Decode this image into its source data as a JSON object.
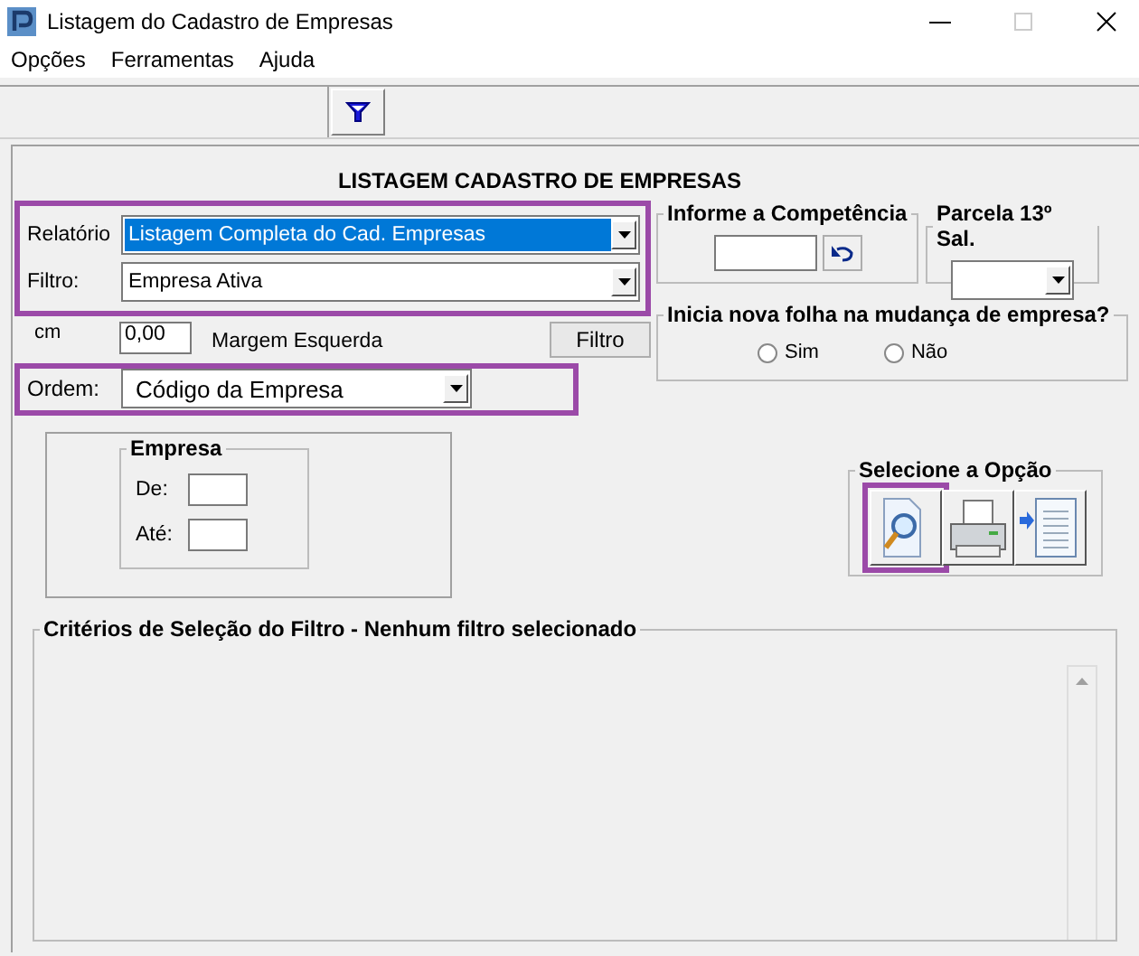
{
  "window": {
    "title": "Listagem do Cadastro de Empresas"
  },
  "menu": [
    "Opções",
    "Ferramentas",
    "Ajuda"
  ],
  "toolbar": {
    "buttons": [
      {
        "kind": "filter"
      }
    ]
  },
  "heading": "LISTAGEM CADASTRO DE EMPRESAS",
  "report": {
    "highlighted": true,
    "fields": [
      {
        "label": "Relatório",
        "value": "Listagem Completa do Cad. Empresas",
        "focused": true
      },
      {
        "label": "Filtro:",
        "value": "Empresa Ativa",
        "focused": false
      }
    ]
  },
  "margin": {
    "unit": "cm",
    "value": "0,00",
    "label": "Margem Esquerda"
  },
  "filter_button": "Filtro",
  "order": {
    "highlighted": true,
    "label": "Ordem:",
    "value": "Código da Empresa"
  },
  "competencia": {
    "title": "Informe a Competência"
  },
  "parcela": {
    "title": "Parcela 13º Sal."
  },
  "new_sheet": {
    "title": "Inicia nova folha na mudança de empresa?",
    "options": [
      {
        "label": "Sim",
        "selected": false
      },
      {
        "label": "Não",
        "selected": false
      }
    ]
  },
  "empresa": {
    "title": "Empresa",
    "fields": [
      {
        "label": "De:"
      },
      {
        "label": "Até:"
      }
    ]
  },
  "output": {
    "title": "Selecione a Opção",
    "buttons": [
      {
        "kind": "preview",
        "highlighted": true
      },
      {
        "kind": "print",
        "highlighted": false
      },
      {
        "kind": "export",
        "highlighted": false
      }
    ]
  },
  "criteria": {
    "title": "Critérios de Seleção do Filtro - Nenhum filtro selecionado"
  }
}
